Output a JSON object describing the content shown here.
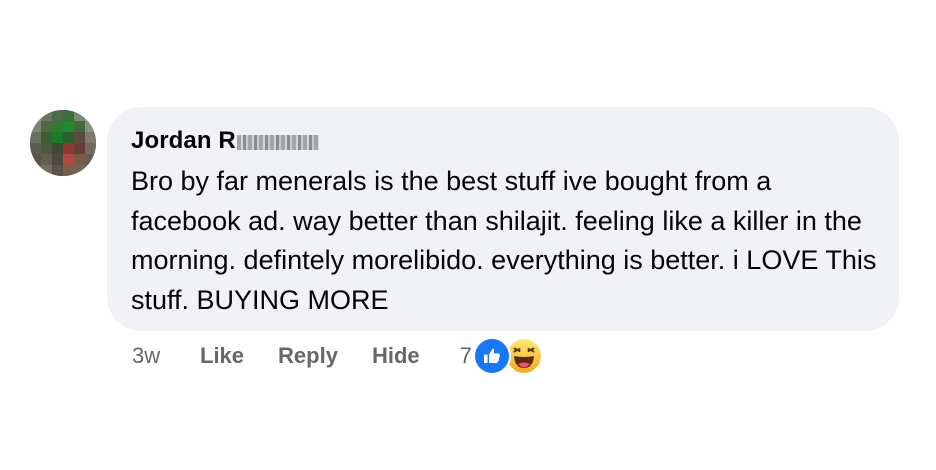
{
  "comment": {
    "author_visible": "Jordan R",
    "text": "Bro by far menerals is the best stuff ive bought from a facebook ad. way better than shilajit. feeling like a killer in the morning. defintely morelibido. everything is better. i LOVE This stuff. BUYING MORE"
  },
  "actions": {
    "time": "3w",
    "like_label": "Like",
    "reply_label": "Reply",
    "hide_label": "Hide",
    "reaction_count": "7",
    "reactions": [
      "like-icon",
      "haha-icon"
    ]
  },
  "colors": {
    "bubble": "#f0f2f5",
    "text": "#050505",
    "muted": "#65676b",
    "like_blue": "#1877f2",
    "haha_yellow": "#f7c33f"
  }
}
